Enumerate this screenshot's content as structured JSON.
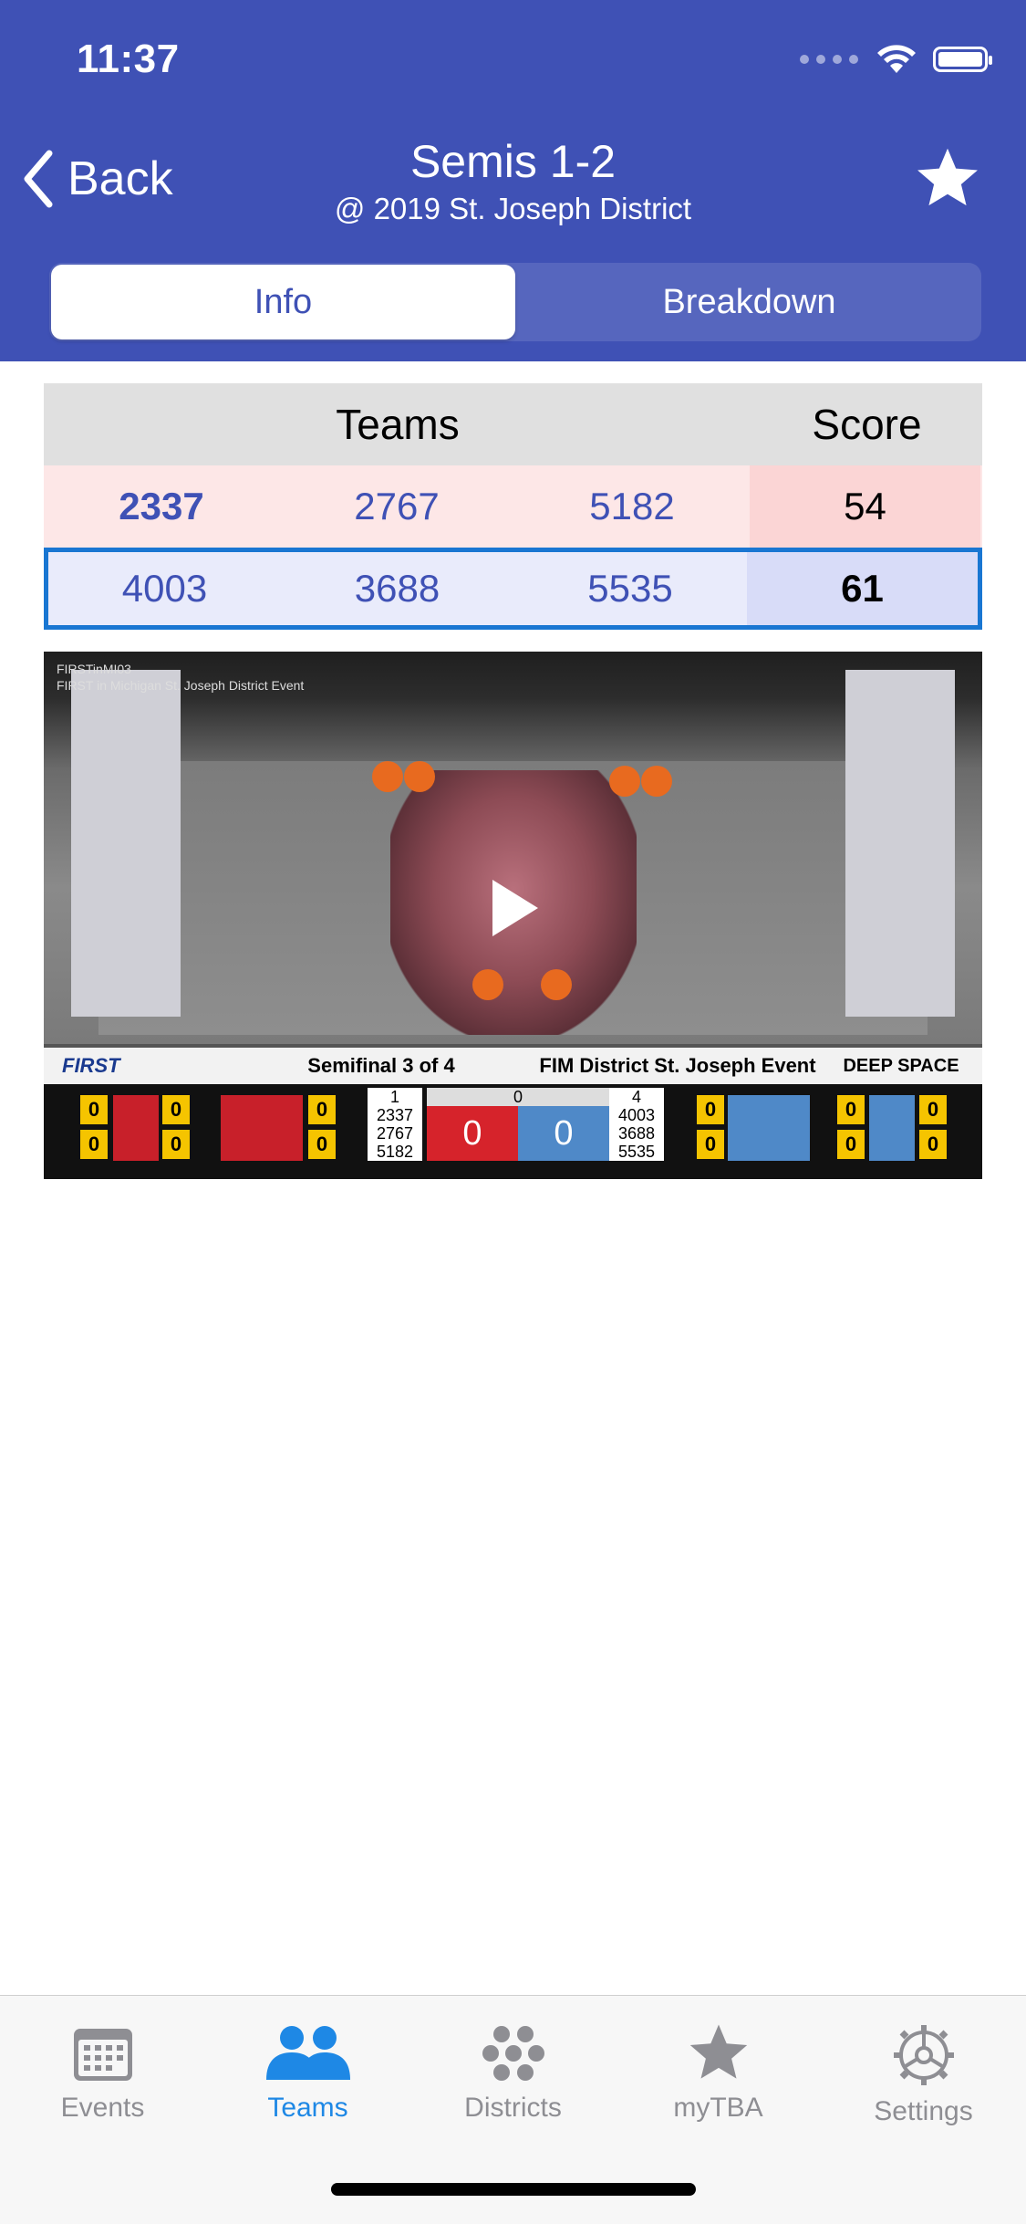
{
  "status_bar": {
    "time": "11:37"
  },
  "nav": {
    "back_label": "Back",
    "title": "Semis 1-2",
    "subtitle": "@ 2019 St. Joseph District"
  },
  "segments": {
    "info": "Info",
    "breakdown": "Breakdown",
    "selected": "Info"
  },
  "table": {
    "header_teams": "Teams",
    "header_score": "Score",
    "red": {
      "teams": [
        "2337",
        "2767",
        "5182"
      ],
      "score": "54"
    },
    "blue": {
      "teams": [
        "4003",
        "3688",
        "5535"
      ],
      "score": "61"
    }
  },
  "video": {
    "channel_text": "FIRSTinMI03",
    "channel_sub": "FIRST in Michigan St. Joseph District Event",
    "brand": "FIRST",
    "match_label": "Semifinal 3 of 4",
    "event_label": "FIM District St. Joseph Event",
    "game_label": "DEEP SPACE",
    "red_alliance_no": "1",
    "blue_alliance_no": "4",
    "red_score": "0",
    "blue_score": "0",
    "timer": "0",
    "red_teams": [
      "2337",
      "2767",
      "5182"
    ],
    "blue_teams": [
      "4003",
      "3688",
      "5535"
    ],
    "counter_zero": "0"
  },
  "tabbar": {
    "items": [
      {
        "label": "Events",
        "icon": "calendar-icon"
      },
      {
        "label": "Teams",
        "icon": "people-icon"
      },
      {
        "label": "Districts",
        "icon": "dots-icon"
      },
      {
        "label": "myTBA",
        "icon": "star-icon"
      },
      {
        "label": "Settings",
        "icon": "gear-icon"
      }
    ],
    "selected": "Teams"
  },
  "colors": {
    "brand": "#3f51b5",
    "active_tab": "#1e88e5",
    "red_row": "#fde7e7",
    "blue_row": "#e9ebfb",
    "blue_border": "#1976d2"
  }
}
